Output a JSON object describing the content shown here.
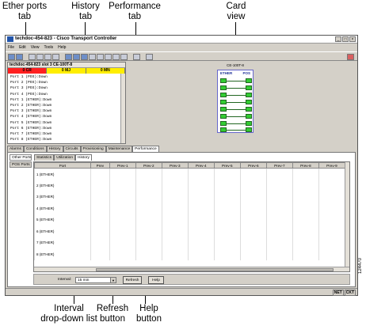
{
  "callouts": {
    "ether_ports_tab": "Ether ports\ntab",
    "history_tab": "History\ntab",
    "performance_tab": "Performance\ntab",
    "card_view": "Card\nview",
    "interval_list": "Interval\ndrop-down list",
    "refresh_button": "Refresh\nbutton",
    "help_button": "Help\nbutton"
  },
  "figure_id": "124470",
  "window": {
    "title": "techdoc-454-823 - Cisco Transport Controller",
    "menu": [
      "File",
      "Edit",
      "View",
      "Tools",
      "Help"
    ]
  },
  "node": {
    "header": "techdoc-454-823 slot 3 CE-100T-8",
    "alarms": [
      "0 CR",
      "0 MJ",
      "0 MN"
    ],
    "ports": [
      "Port 1 (POS):Down",
      "Port 2 (POS):Down",
      "Port 3 (POS):Down",
      "Port 4 (POS):Down",
      "Port 1 (ETHER):Down",
      "Port 2 (ETHER):Down",
      "Port 3 (ETHER):Down",
      "Port 4 (ETHER):Down",
      "Port 5 (ETHER):Down",
      "Port 6 (ETHER):Down",
      "Port 7 (ETHER):Down",
      "Port 8 (ETHER):Down"
    ]
  },
  "card": {
    "label": "CE-100T-8",
    "left_col": "ETHER",
    "right_col": "POS"
  },
  "main_tabs": [
    "Alarms",
    "Conditions",
    "History",
    "Circuits",
    "Provisioning",
    "Maintenance",
    "Performance"
  ],
  "side_tabs": [
    "Other Ports",
    "POS Ports"
  ],
  "sub_tabs": [
    "Statistics",
    "Utilization",
    "History"
  ],
  "table": {
    "headers": [
      "Port",
      "Prev",
      "Prev-1",
      "Prev-2",
      "Prev-3",
      "Prev-4",
      "Prev-5",
      "Prev-6",
      "Prev-7",
      "Prev-8",
      "Prev-9"
    ],
    "rows": [
      "1 (ETHER)",
      "2 (ETHER)",
      "3 (ETHER)",
      "4 (ETHER)",
      "5 (ETHER)",
      "6 (ETHER)",
      "7 (ETHER)",
      "8 (ETHER)"
    ]
  },
  "controls": {
    "interval_label": "Interval:",
    "interval_value": "15 min",
    "refresh_label": "Refresh",
    "help_label": "Help"
  },
  "status": [
    "NET",
    "CKT"
  ]
}
